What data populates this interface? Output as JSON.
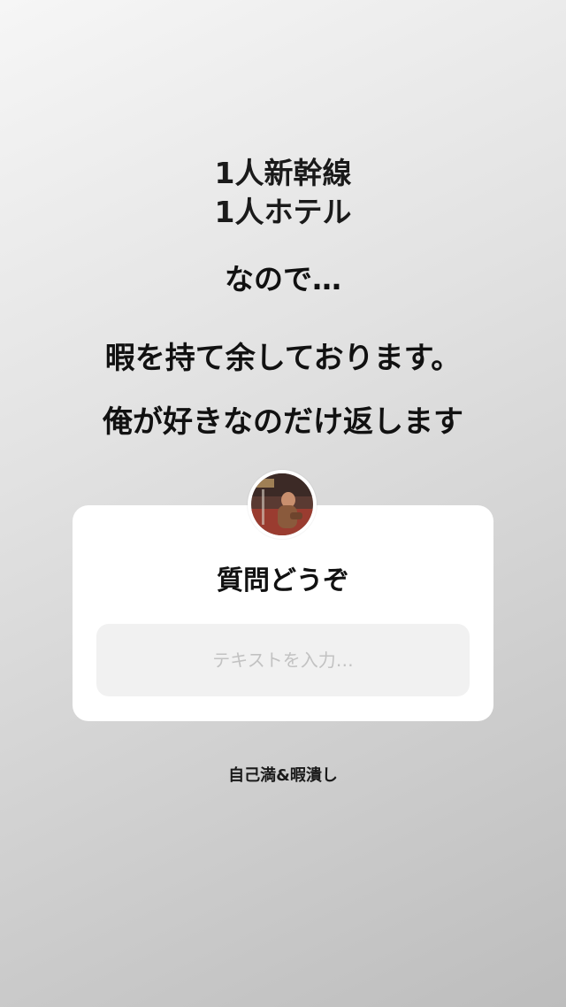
{
  "story": {
    "lines": [
      "1人新幹線",
      "1人ホテル",
      "なので…",
      "暇を持て余しております。",
      "俺が好きなのだけ返します"
    ]
  },
  "question_sticker": {
    "title": "質問どうぞ",
    "input_placeholder": "テキストを入力…",
    "avatar_icon": "profile-photo"
  },
  "caption": "自己満&暇潰し",
  "colors": {
    "text": "#111111",
    "card_bg": "#ffffff",
    "input_bg": "#f1f1f1",
    "placeholder": "#c2c2c2"
  }
}
